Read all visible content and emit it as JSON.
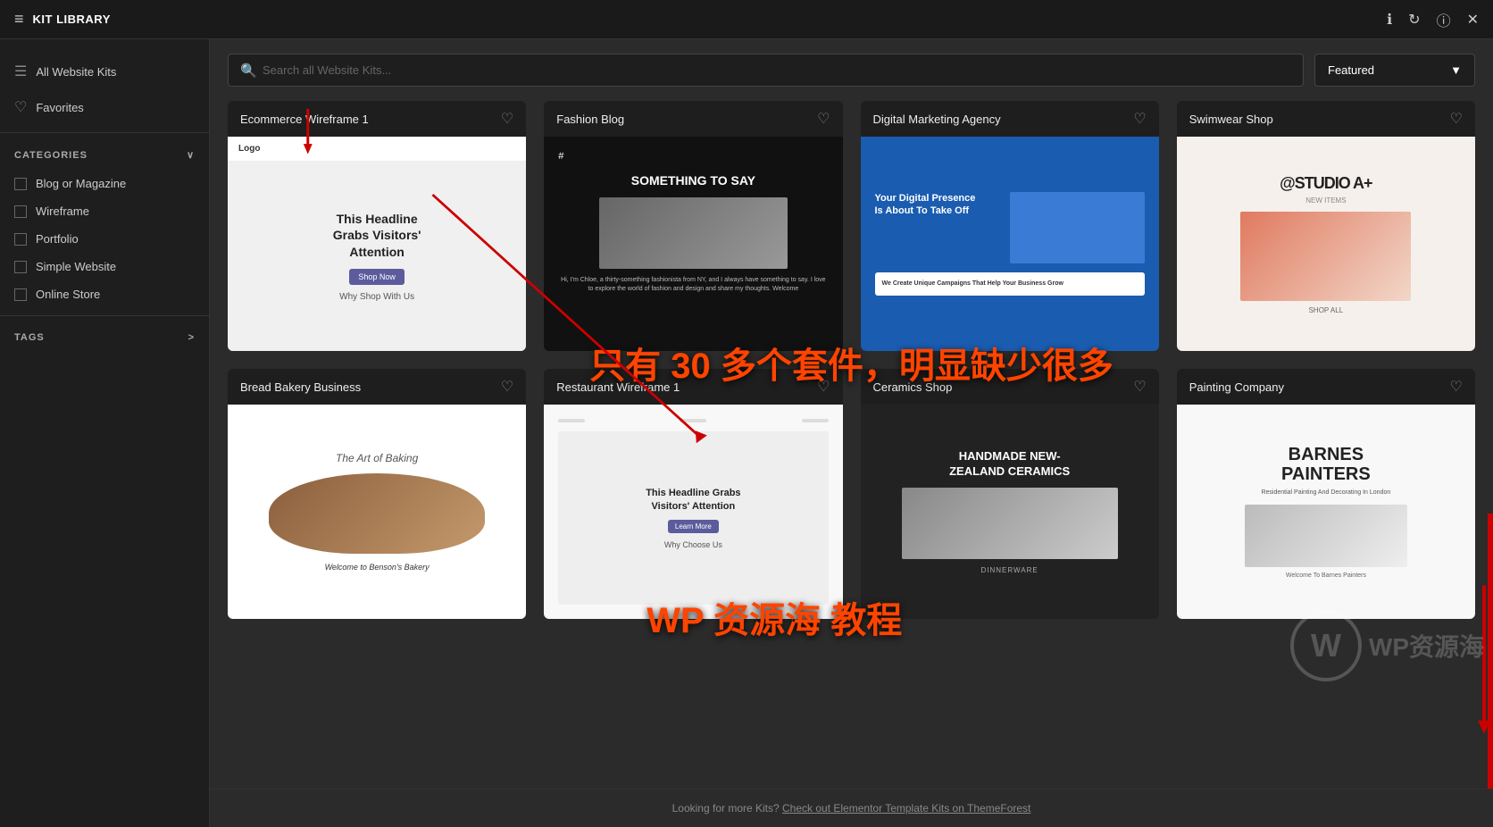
{
  "app": {
    "title": "KIT LIBRARY",
    "menu_icon": "≡",
    "all_kits_label": "All Website Kits",
    "favorites_label": "Favorites"
  },
  "topbar": {
    "info_icon": "ℹ",
    "refresh_icon": "↻",
    "info2_icon": "ⓘ",
    "close_icon": "✕"
  },
  "search": {
    "placeholder": "Search all Website Kits...",
    "filter_label": "Featured",
    "filter_arrow": "▼"
  },
  "sidebar": {
    "categories_label": "CATEGORIES",
    "categories_arrow": "∨",
    "categories": [
      {
        "label": "Blog or Magazine",
        "checked": false
      },
      {
        "label": "Wireframe",
        "checked": false
      },
      {
        "label": "Portfolio",
        "checked": false
      },
      {
        "label": "Simple Website",
        "checked": false
      },
      {
        "label": "Online Store",
        "checked": false
      }
    ],
    "tags_label": "TAGS",
    "tags_arrow": ">"
  },
  "grid": {
    "cards": [
      {
        "title": "Ecommerce Wireframe 1",
        "favorited": false
      },
      {
        "title": "Fashion Blog",
        "favorited": false
      },
      {
        "title": "Digital Marketing Agency",
        "favorited": false
      },
      {
        "title": "Swimwear Shop",
        "favorited": false
      },
      {
        "title": "Bread Bakery Business",
        "favorited": false
      },
      {
        "title": "Restaurant Wireframe 1",
        "favorited": false
      },
      {
        "title": "Ceramics Shop",
        "favorited": false
      },
      {
        "title": "Painting Company",
        "favorited": false
      }
    ]
  },
  "overlay": {
    "text1": "只有 30 多个套件，明显缺少很多",
    "text2": "WP 资源海 教程"
  },
  "footer": {
    "text": "Looking for more Kits?",
    "link_text": "Check out Elementor Template Kits on ThemeForest"
  }
}
